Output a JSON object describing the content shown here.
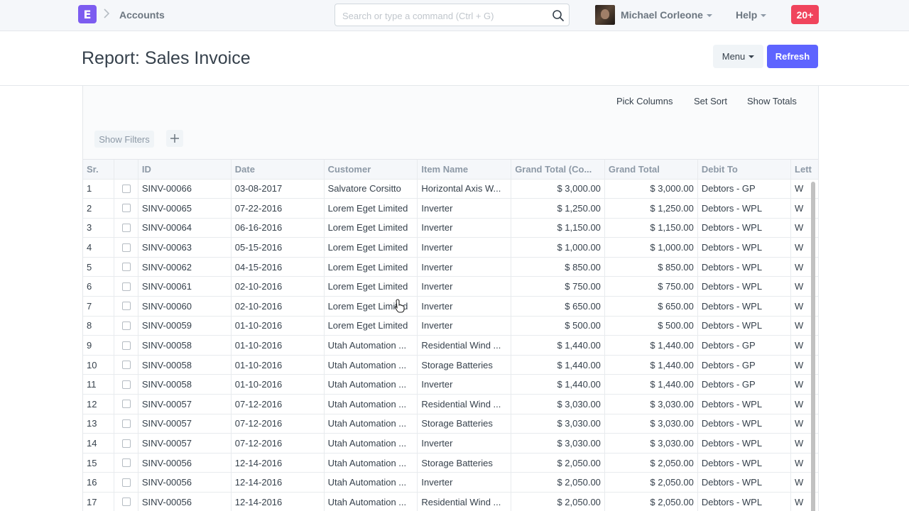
{
  "navbar": {
    "logo": "E",
    "breadcrumb": "Accounts",
    "search_placeholder": "Search or type a command (Ctrl + G)",
    "user_name": "Michael Corleone",
    "help_label": "Help",
    "notification_count": "20+"
  },
  "page": {
    "title": "Report: Sales Invoice",
    "menu_label": "Menu",
    "refresh_label": "Refresh"
  },
  "toolbar": {
    "pick_columns": "Pick Columns",
    "set_sort": "Set Sort",
    "show_totals": "Show Totals",
    "show_filters": "Show Filters"
  },
  "table": {
    "columns": [
      "Sr.",
      "",
      "ID",
      "Date",
      "Customer",
      "Item Name",
      "Grand Total (Co...",
      "Grand Total",
      "Debit To",
      "Lett"
    ],
    "rows": [
      [
        "1",
        "SINV-00066",
        "03-08-2017",
        "Salvatore Corsitto",
        "Horizontal Axis W...",
        "$ 3,000.00",
        "$ 3,000.00",
        "Debtors - GP",
        "W"
      ],
      [
        "2",
        "SINV-00065",
        "07-22-2016",
        "Lorem Eget Limited",
        "Inverter",
        "$ 1,250.00",
        "$ 1,250.00",
        "Debtors - WPL",
        "W"
      ],
      [
        "3",
        "SINV-00064",
        "06-16-2016",
        "Lorem Eget Limited",
        "Inverter",
        "$ 1,150.00",
        "$ 1,150.00",
        "Debtors - WPL",
        "W"
      ],
      [
        "4",
        "SINV-00063",
        "05-15-2016",
        "Lorem Eget Limited",
        "Inverter",
        "$ 1,000.00",
        "$ 1,000.00",
        "Debtors - WPL",
        "W"
      ],
      [
        "5",
        "SINV-00062",
        "04-15-2016",
        "Lorem Eget Limited",
        "Inverter",
        "$ 850.00",
        "$ 850.00",
        "Debtors - WPL",
        "W"
      ],
      [
        "6",
        "SINV-00061",
        "02-10-2016",
        "Lorem Eget Limited",
        "Inverter",
        "$ 750.00",
        "$ 750.00",
        "Debtors - WPL",
        "W"
      ],
      [
        "7",
        "SINV-00060",
        "02-10-2016",
        "Lorem Eget Limited",
        "Inverter",
        "$ 650.00",
        "$ 650.00",
        "Debtors - WPL",
        "W"
      ],
      [
        "8",
        "SINV-00059",
        "01-10-2016",
        "Lorem Eget Limited",
        "Inverter",
        "$ 500.00",
        "$ 500.00",
        "Debtors - WPL",
        "W"
      ],
      [
        "9",
        "SINV-00058",
        "01-10-2016",
        "Utah Automation ...",
        "Residential Wind ...",
        "$ 1,440.00",
        "$ 1,440.00",
        "Debtors - GP",
        "W"
      ],
      [
        "10",
        "SINV-00058",
        "01-10-2016",
        "Utah Automation ...",
        "Storage Batteries",
        "$ 1,440.00",
        "$ 1,440.00",
        "Debtors - GP",
        "W"
      ],
      [
        "11",
        "SINV-00058",
        "01-10-2016",
        "Utah Automation ...",
        "Inverter",
        "$ 1,440.00",
        "$ 1,440.00",
        "Debtors - GP",
        "W"
      ],
      [
        "12",
        "SINV-00057",
        "07-12-2016",
        "Utah Automation ...",
        "Residential Wind ...",
        "$ 3,030.00",
        "$ 3,030.00",
        "Debtors - WPL",
        "W"
      ],
      [
        "13",
        "SINV-00057",
        "07-12-2016",
        "Utah Automation ...",
        "Storage Batteries",
        "$ 3,030.00",
        "$ 3,030.00",
        "Debtors - WPL",
        "W"
      ],
      [
        "14",
        "SINV-00057",
        "07-12-2016",
        "Utah Automation ...",
        "Inverter",
        "$ 3,030.00",
        "$ 3,030.00",
        "Debtors - WPL",
        "W"
      ],
      [
        "15",
        "SINV-00056",
        "12-14-2016",
        "Utah Automation ...",
        "Storage Batteries",
        "$ 2,050.00",
        "$ 2,050.00",
        "Debtors - WPL",
        "W"
      ],
      [
        "16",
        "SINV-00056",
        "12-14-2016",
        "Utah Automation ...",
        "Inverter",
        "$ 2,050.00",
        "$ 2,050.00",
        "Debtors - WPL",
        "W"
      ],
      [
        "17",
        "SINV-00056",
        "12-14-2016",
        "Utah Automation ...",
        "Residential Wind ...",
        "$ 2,050.00",
        "$ 2,050.00",
        "Debtors - WPL",
        "W"
      ]
    ]
  },
  "colors": {
    "brand": "#7c5cf0",
    "primary_button": "#5e64ff",
    "notification": "#f0445c"
  },
  "icons": {
    "search": "search-icon",
    "add_filter": "plus-icon",
    "breadcrumb_separator": "chevron-right-icon",
    "dropdown": "caret-down-icon"
  }
}
